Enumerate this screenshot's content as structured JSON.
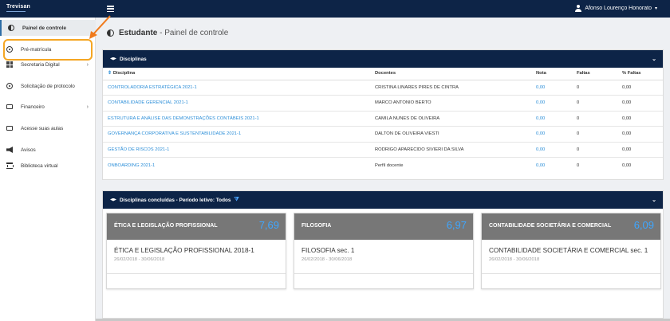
{
  "topbar": {
    "brand": "Trevisan",
    "user_name": "Afonso Lourenço Honorato"
  },
  "sidebar": {
    "items": [
      {
        "label": "Painel de controle"
      },
      {
        "label": "Pré-matrícula"
      },
      {
        "label": "Secretaria Digital"
      },
      {
        "label": "Solicitação de protocolo"
      },
      {
        "label": "Financeiro"
      },
      {
        "label": "Acesse suas aulas"
      },
      {
        "label": "Avisos"
      },
      {
        "label": "Biblioteca virtual"
      }
    ]
  },
  "page": {
    "title": "Estudante",
    "subtitle": " - Painel de controle"
  },
  "disciplinas": {
    "header": "Disciplinas",
    "columns": [
      "Disciplina",
      "Docentes",
      "Nota",
      "Faltas",
      "% Faltas"
    ],
    "rows": [
      {
        "disciplina": "CONTROLADORIA ESTRATÉGICA 2021-1",
        "docente": "CRISTINA LINARES PIRES DE CINTRA",
        "nota": "0,00",
        "faltas": "0",
        "pct": "0,00"
      },
      {
        "disciplina": "CONTABILIDADE GERENCIAL 2021-1",
        "docente": "MARCO ANTONIO BERTO",
        "nota": "0,00",
        "faltas": "0",
        "pct": "0,00"
      },
      {
        "disciplina": "ESTRUTURA E ANÁLISE DAS DEMONSTRAÇÕES CONTÁBEIS 2021-1",
        "docente": "CAMILA NUNES DE OLIVEIRA",
        "nota": "0,00",
        "faltas": "0",
        "pct": "0,00"
      },
      {
        "disciplina": "GOVERNANÇA CORPORATIVA E SUSTENTABILIDADE 2021-1",
        "docente": "DALTON DE OLIVEIRA VIESTI",
        "nota": "0,00",
        "faltas": "0",
        "pct": "0,00"
      },
      {
        "disciplina": "GESTÃO DE RISCOS 2021-1",
        "docente": "RODRIGO APARECIDO SIVIERI DA SILVA",
        "nota": "0,00",
        "faltas": "0",
        "pct": "0,00"
      },
      {
        "disciplina": "ONBOARDING 2021-1",
        "docente": "Perfil docente",
        "nota": "0,00",
        "faltas": "0",
        "pct": "0,00"
      }
    ]
  },
  "concluidas": {
    "header": "Disciplinas concluídas - Período letivo: Todos",
    "cards": [
      {
        "title": "ÉTICA E LEGISLAÇÃO PROFISSIONAL",
        "grade": "7,69",
        "name": "ÉTICA E LEGISLAÇÃO PROFISSIONAL 2018-1",
        "dates": "26/02/2018 - 30/06/2018"
      },
      {
        "title": "FILOSOFIA",
        "grade": "6,97",
        "name": "FILOSOFIA sec. 1",
        "dates": "26/02/2018 - 30/06/2018"
      },
      {
        "title": "CONTABILIDADE SOCIETÁRIA E COMERCIAL",
        "grade": "6,09",
        "name": "CONTABILIDADE SOCIETÁRIA E COMERCIAL sec. 1",
        "dates": "26/02/2018 - 30/06/2018"
      }
    ]
  },
  "colors": {
    "navy": "#0d2447",
    "link": "#2b8ed8",
    "highlight": "#f5a623",
    "card_header": "#777777"
  }
}
